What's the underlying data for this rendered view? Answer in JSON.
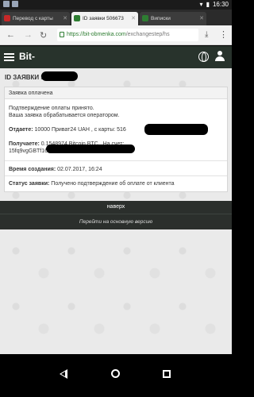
{
  "statusbar": {
    "time": "16:30"
  },
  "tabs": [
    {
      "label": "Перевод с карты",
      "fav_color": "#c62828"
    },
    {
      "label": "ID заявки 506673",
      "fav_color": "#2e7d32"
    },
    {
      "label": "Виписки",
      "fav_color": "#2e7d32"
    }
  ],
  "addressbar": {
    "domain": "https://bit-obmenka.com",
    "path": "/exchangestep/hs"
  },
  "site": {
    "brand": "Bit-"
  },
  "page": {
    "id_title": "ID ЗАЯВКИ 5",
    "card": {
      "status_header": "Заявка оплачена",
      "msg_line1": "Подтверждение оплаты принято.",
      "msg_line2": "Ваша заявка обрабатывается оператором.",
      "send_label": "Отдаете:",
      "send_value": "10000 Приват24 UAH , с карты: 516",
      "recv_label": "Получаете:",
      "recv_value": "0.1548974 Bitcoin BTC , На счет:",
      "recv_account": "15fq9vgGBTf16b",
      "created_label": "Время создания:",
      "created_value": "02.07.2017, 16:24",
      "status_label": "Статус заявки:",
      "status_value": "Получено подтверждение об оплате от клиента"
    },
    "footer": {
      "up_label": "наверх",
      "full_version_label": "Перейти на основную версию"
    }
  }
}
